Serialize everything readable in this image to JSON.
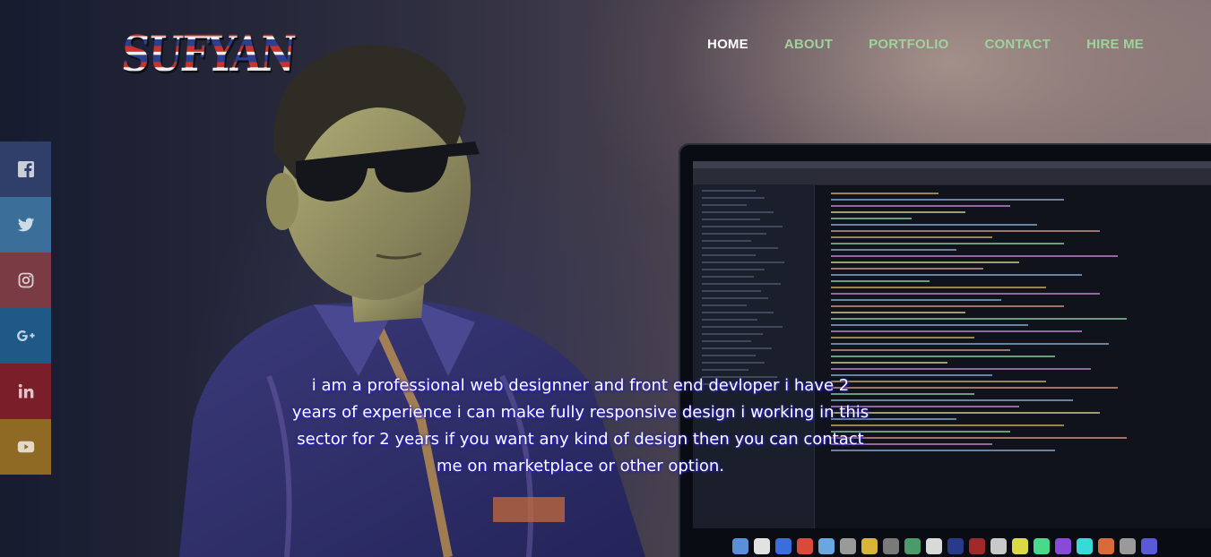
{
  "logo": {
    "text": "SUFYAN"
  },
  "nav": {
    "items": [
      {
        "label": "HOME",
        "active": true
      },
      {
        "label": "ABOUT",
        "active": false
      },
      {
        "label": "PORTFOLIO",
        "active": false
      },
      {
        "label": "CONTACT",
        "active": false
      },
      {
        "label": "HIRE ME",
        "active": false
      }
    ],
    "active_color": "#ffffff",
    "inactive_color": "#9fd29c"
  },
  "social": [
    {
      "icon": "facebook-icon",
      "color": "#2f3f69"
    },
    {
      "icon": "twitter-icon",
      "color": "#3b6f9a"
    },
    {
      "icon": "instagram-icon",
      "color": "#7a3b45"
    },
    {
      "icon": "google-plus-icon",
      "color": "#1f5a86"
    },
    {
      "icon": "linkedin-icon",
      "color": "#7a1f2a"
    },
    {
      "icon": "youtube-icon",
      "color": "#8f6a24"
    }
  ],
  "bio": {
    "text": "i am a professional web designner and front end devloper i have 2 years of experience i can make fully responsive design i working in this sector for 2 years if you want any kind of design then you can contact me on marketplace or other option."
  }
}
